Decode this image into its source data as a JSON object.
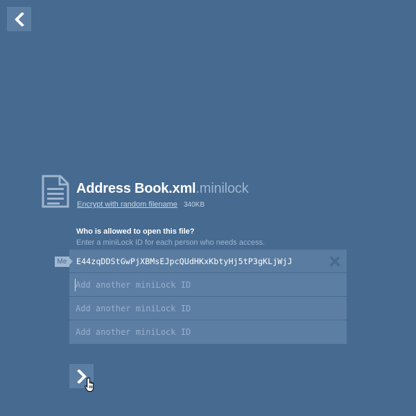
{
  "nav": {
    "back_icon": "chevron-left-icon",
    "next_icon": "chevron-right-icon"
  },
  "file": {
    "icon": "document-icon",
    "name": "Address Book.xml",
    "extension": ".minilock",
    "encrypt_link": "Encrypt with random filename",
    "size": "340KB"
  },
  "recipients": {
    "title": "Who is allowed to open this file?",
    "subtitle": "Enter a miniLock ID for each person who needs access.",
    "me_tag": "Me",
    "my_id": "E44zqDDStGwPjXBMsEJpcQUdHKxKbtyHj5tP3gKLjWjJ",
    "remove_icon": "close-icon",
    "inputs": [
      {
        "value": "",
        "placeholder": "Add another miniLock ID"
      },
      {
        "value": "",
        "placeholder": "Add another miniLock ID"
      },
      {
        "value": "",
        "placeholder": "Add another miniLock ID"
      }
    ]
  },
  "colors": {
    "background": "#466a90",
    "panel": "#5c7ea3",
    "text": "#ffffff",
    "muted": "#9fb6cf"
  }
}
